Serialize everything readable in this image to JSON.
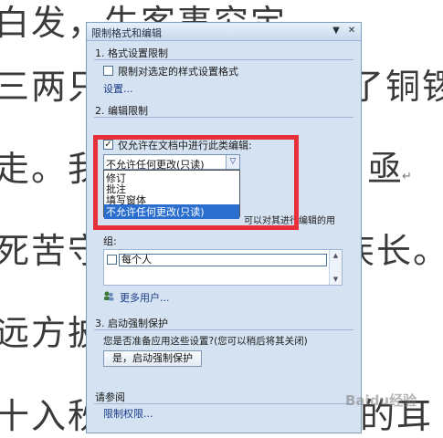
{
  "document": {
    "lines": [
      "白发，生客事究定",
      "三两只",
      "走。我",
      "死苦守",
      "远方披",
      "十入秋。疾风灌满了他的耳"
    ],
    "right_fragments": [
      "了铜锣",
      "亟",
      "疾长。"
    ]
  },
  "pane": {
    "title": "限制格式和编辑",
    "dropdown_btn": "▼",
    "close_btn": "✕",
    "section1": {
      "title": "1. 格式设置限制",
      "checkbox_label": "限制对选定的样式设置格式",
      "checked": false,
      "link": "设置..."
    },
    "section2": {
      "title": "2. 编辑限制",
      "checkbox_label": "仅允许在文档中进行此类编辑:",
      "checked": true,
      "check_mark": "✓",
      "select": {
        "value": "不允许任何更改(只读)",
        "arrow": "▽",
        "options": [
          "修订",
          "批注",
          "填写窗体",
          "不允许任何更改(只读)"
        ],
        "selected_index": 3
      },
      "partial_text": "可以对其进行编辑的用",
      "group_label": "组:",
      "group_item": "每个人",
      "more_users": "更多用户..."
    },
    "section3": {
      "title": "3. 启动强制保护",
      "question": "您是否准备应用这些设置?(您可以稍后将其关闭)",
      "button": "是，启动强制保护"
    },
    "see_also": {
      "title": "请参阅",
      "link": "限制权限..."
    }
  },
  "watermark": "Baidu经验"
}
